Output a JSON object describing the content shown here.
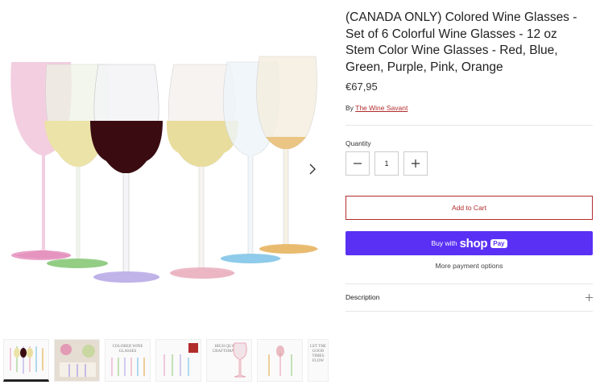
{
  "product": {
    "title": "(CANADA ONLY) Colored Wine Glasses - Set of 6 Colorful Wine Glasses - 12 oz Stem Color Wine Glasses - Red, Blue, Green, Purple, Pink, Orange",
    "price": "€67,95",
    "by_prefix": "By",
    "vendor": "The Wine Savant"
  },
  "quantity": {
    "label": "Quantity",
    "value": "1",
    "decrease_icon": "minus-icon",
    "increase_icon": "plus-icon"
  },
  "buttons": {
    "add_to_cart": "Add to Cart",
    "shoppay_buy_with": "Buy with",
    "shoppay_shop": "shop",
    "shoppay_pay": "Pay",
    "more_payment": "More payment options"
  },
  "description": {
    "label": "Description",
    "toggle_icon": "plus-icon"
  },
  "gallery": {
    "next_icon": "chevron-right-icon",
    "glass_colors": [
      "#e7a6c6",
      "#9fd08a",
      "#b7a8e6",
      "#e8a8b8",
      "#7ec3e8",
      "#e6b25a"
    ],
    "wine_colors": [
      "",
      "#ece3a8",
      "#3a0c12",
      "#e9dd9d",
      "",
      ""
    ],
    "thumbnails": [
      {
        "text": ""
      },
      {
        "text": ""
      },
      {
        "text": "COLORED WINE GLASSES"
      },
      {
        "text": ""
      },
      {
        "text": "HIGH QUALITY CRAFTSMANSHIP"
      },
      {
        "text": ""
      },
      {
        "text": "LET THE GOOD TIMES FLOW"
      }
    ]
  },
  "colors": {
    "accent_red": "#b22c2c",
    "shoppay_purple": "#5a31f4"
  }
}
